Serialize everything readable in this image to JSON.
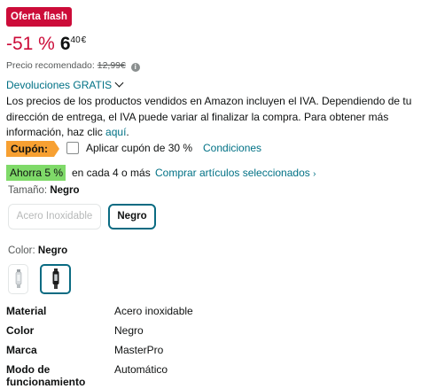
{
  "badge": "Oferta flash",
  "price": {
    "discount": "-51 %",
    "whole": "6",
    "fraction": "40",
    "currency": "€",
    "recommended_label": "Precio recomendado:",
    "recommended_value": "12,99€"
  },
  "returns": {
    "label": "Devoluciones GRATIS"
  },
  "vat": {
    "text": "Los precios de los productos vendidos en Amazon incluyen el IVA. Dependiendo de tu dirección de entrega, el IVA puede variar al finalizar la compra. Para obtener más información, haz clic ",
    "link": "aquí",
    "end": "."
  },
  "coupon": {
    "tag": "Cupón:",
    "checkbox_label": "Aplicar cupón de 30 %",
    "conditions": "Condiciones"
  },
  "subscribe": {
    "tag": "Ahorra 5 %",
    "text": "en cada 4 o más",
    "link": "Comprar artículos seleccionados",
    "chev": "›"
  },
  "size": {
    "label": "Tamaño:",
    "selected": "Negro",
    "options": [
      "Acero Inoxidable",
      "Negro"
    ]
  },
  "color": {
    "label": "Color:",
    "selected": "Negro"
  },
  "specs": [
    {
      "key": "Material",
      "value": "Acero inoxidable"
    },
    {
      "key": "Color",
      "value": "Negro"
    },
    {
      "key": "Marca",
      "value": "MasterPro"
    },
    {
      "key": "Modo de funcionamiento",
      "value": "Automático"
    }
  ],
  "colors": {
    "deal_red": "#cc0c39",
    "link_teal": "#007185",
    "coupon_orange": "#f7a032",
    "save_green": "#7fda69",
    "selected_border": "#0a6b82"
  }
}
